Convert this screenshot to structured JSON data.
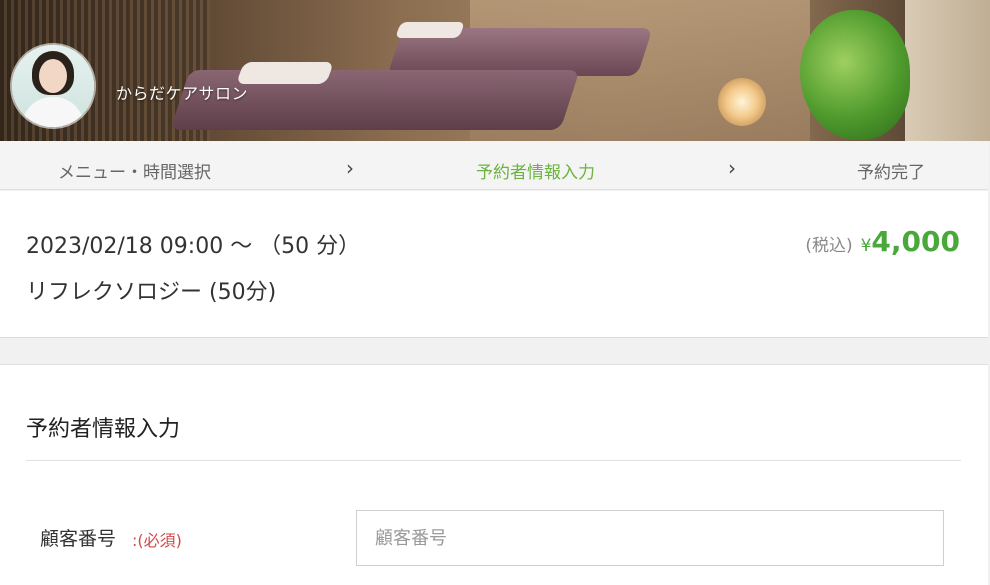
{
  "header": {
    "shop_name": "からだケアサロン"
  },
  "steps": [
    {
      "label": "メニュー・時間選択",
      "active": false
    },
    {
      "label": "予約者情報入力",
      "active": true
    },
    {
      "label": "予約完了",
      "active": false
    }
  ],
  "step_separator": "›",
  "summary": {
    "datetime": "2023/02/18 09:00 〜 （50 分）",
    "menu_name": "リフレクソロジー (50分)",
    "tax_label": "(税込)",
    "currency": "¥",
    "price": "4,000"
  },
  "form": {
    "section_title": "予約者情報入力",
    "customer_number_label": "顧客番号",
    "required_mark": ":(必須)",
    "customer_number_placeholder": "顧客番号",
    "customer_number_value": ""
  },
  "colors": {
    "accent_green": "#6cb33f",
    "price_green": "#4aa83a",
    "required_red": "#d04a4a"
  }
}
